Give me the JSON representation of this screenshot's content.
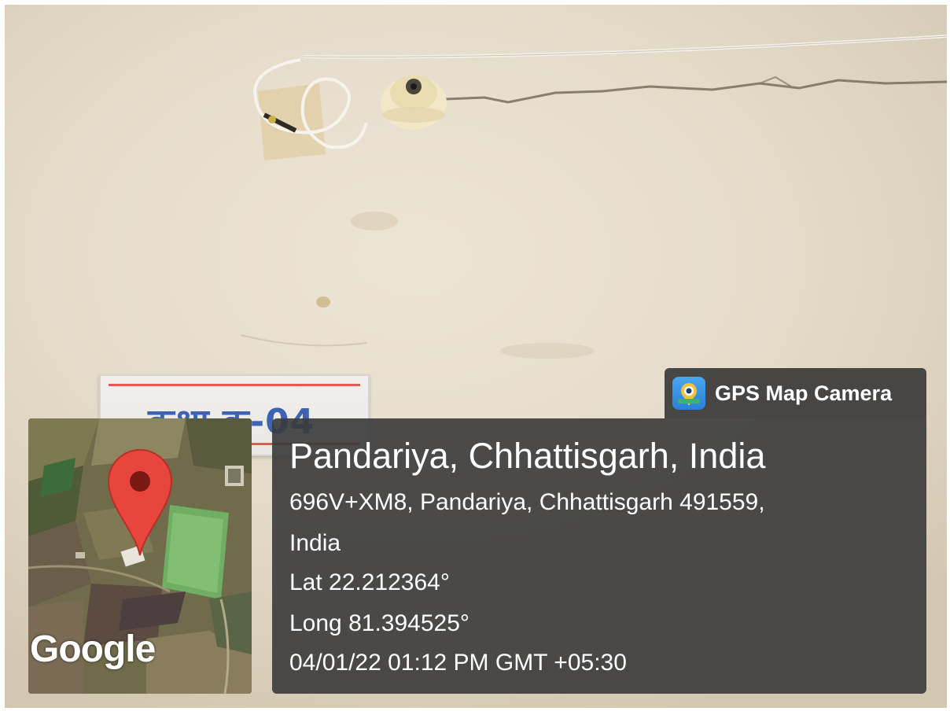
{
  "app": {
    "name": "GPS Map Camera",
    "icon": "gps-map-camera-app-icon"
  },
  "location": {
    "title": "Pandariya, Chhattisgarh, India",
    "address_line1": "696V+XM8, Pandariya, Chhattisgarh 491559,",
    "address_line2": "India",
    "latitude": "Lat 22.212364°",
    "longitude": "Long 81.394525°",
    "datetime": "04/01/22 01:12 PM GMT +05:30"
  },
  "map": {
    "provider_logo": "Google",
    "marker_icon": "map-pin-icon",
    "marker_color": "#e8453c"
  },
  "scene": {
    "sign_text": "कक्षा क्र-04",
    "sign_text_color": "#3f63b3",
    "overlay_color": "#3a3a3a"
  }
}
